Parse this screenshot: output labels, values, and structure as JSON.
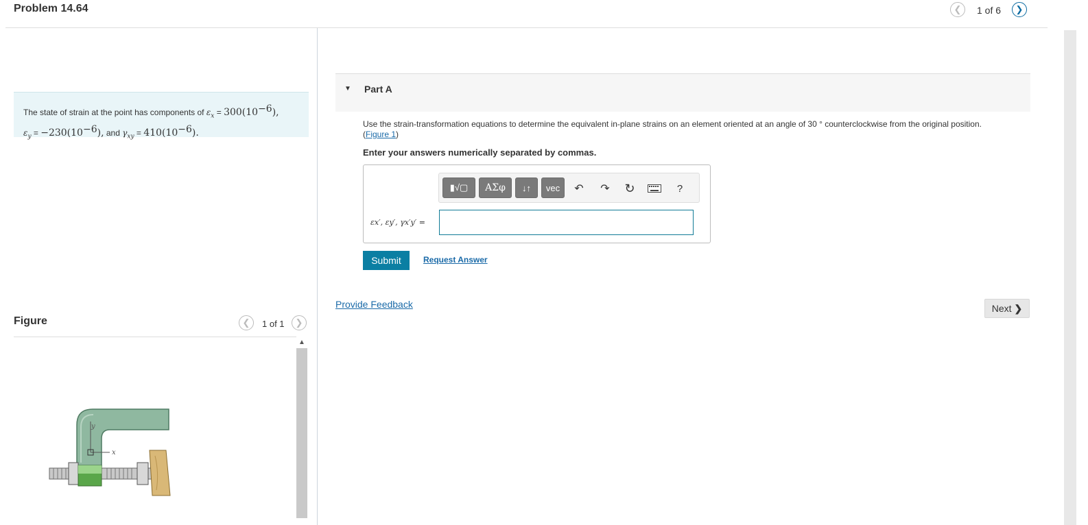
{
  "header": {
    "title": "Problem 14.64",
    "pager": "1 of 6"
  },
  "problem": {
    "text_prefix": "The state of strain at the point has components of",
    "ex_sym": "ε",
    "ex_sub": "x",
    "ex_val": "300(10",
    "ex_exp": "−6",
    "ey_sym": "ε",
    "ey_sub": "y",
    "ey_val": "−230(10",
    "ey_exp": "−6",
    "and": "and",
    "gxy_sym": "γ",
    "gxy_sub": "xy",
    "gxy_val": "410(10",
    "gxy_exp": "−6"
  },
  "figure": {
    "title": "Figure",
    "pager": "1 of 1",
    "axis_y": "y",
    "axis_x": "x"
  },
  "partA": {
    "label": "Part A",
    "question": "Use the strain-transformation equations to determine the equivalent in-plane strains on an element oriented at an angle of 30 ° counterclockwise from the original position.",
    "figure_link": "Figure 1",
    "instruction": "Enter your answers numerically separated by commas.",
    "answer_label": "εx′, εy′, γx′y′ =",
    "answer_value": "",
    "submit": "Submit",
    "request_answer": "Request Answer"
  },
  "toolbar": {
    "templates": "▮√▢",
    "greek": "ΑΣφ",
    "arrows": "↓↑",
    "vec": "vec",
    "help": "?"
  },
  "footer": {
    "feedback": "Provide Feedback",
    "next": "Next"
  }
}
